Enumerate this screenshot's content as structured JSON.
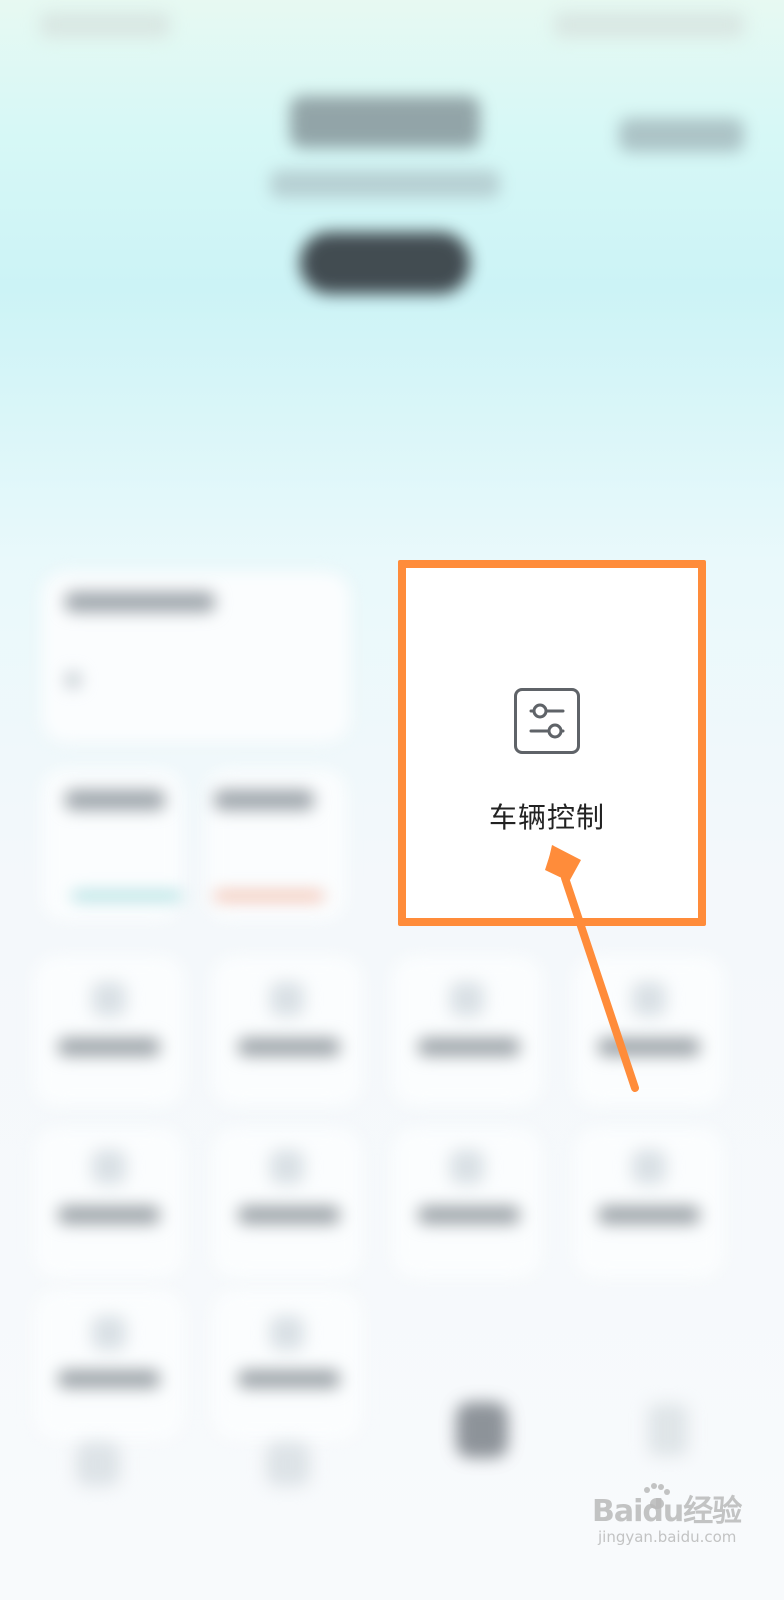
{
  "main_card": {
    "label": "车辆控制",
    "icon": "sliders-control-icon"
  },
  "watermark": {
    "brand": "Baidu经验",
    "site": "jingyan.baidu.com"
  },
  "colors": {
    "highlight": "#ff8c3a",
    "icon": "#5f6368",
    "text": "#222222"
  }
}
